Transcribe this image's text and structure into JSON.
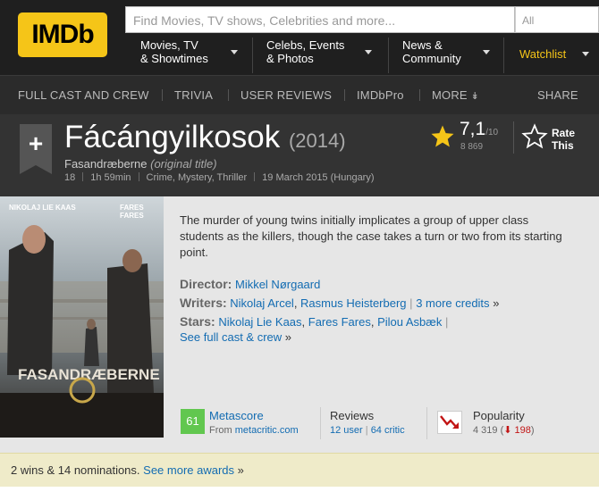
{
  "header": {
    "logo": "IMDb",
    "search_placeholder": "Find Movies, TV shows, Celebrities and more...",
    "search_category": "All",
    "nav": [
      {
        "line1": "Movies, TV",
        "line2": "& Showtimes"
      },
      {
        "line1": "Celebs, Events",
        "line2": "& Photos"
      },
      {
        "line1": "News &",
        "line2": "Community"
      }
    ],
    "watchlist": "Watchlist"
  },
  "subnav": {
    "items": [
      "FULL CAST AND CREW",
      "TRIVIA",
      "USER REVIEWS",
      "IMDbPro",
      "MORE"
    ],
    "share": "SHARE"
  },
  "title": {
    "name": "Fácángyilkosok",
    "year": "(2014)",
    "original": "Fasandræberne",
    "original_note": "(original title)",
    "certificate": "18",
    "runtime": "1h 59min",
    "genres": "Crime, Mystery, Thriller",
    "release": "19 March 2015 (Hungary)",
    "rating": "7,1",
    "rating_max": "/10",
    "votes": "8 869",
    "rate_line1": "Rate",
    "rate_line2": "This"
  },
  "poster": {
    "actor_left": "NIKOLAJ LIE KAAS",
    "actor_right": "FARES FARES",
    "title": "FASANDRÆBERNE"
  },
  "summary": "The murder of young twins initially implicates a group of upper class students as the killers, though the case takes a turn or two from its starting point.",
  "credits": {
    "director_label": "Director:",
    "director": "Mikkel Nørgaard",
    "writers_label": "Writers:",
    "writer1": "Nikolaj Arcel",
    "writer2": "Rasmus Heisterberg",
    "writers_more": "3 more credits",
    "stars_label": "Stars:",
    "star1": "Nikolaj Lie Kaas",
    "star2": "Fares Fares",
    "star3": "Pilou Asbæk",
    "full_cast": "See full cast & crew"
  },
  "metascore": {
    "value": "61",
    "label": "Metascore",
    "from": "From",
    "source": "metacritic.com"
  },
  "reviews": {
    "label": "Reviews",
    "user": "12 user",
    "critic": "64 critic"
  },
  "popularity": {
    "label": "Popularity",
    "rank": "4 319",
    "change": "198"
  },
  "awards": {
    "text": "2 wins & 14 nominations.",
    "link": "See more awards"
  },
  "colors": {
    "brand": "#f5c518",
    "link": "#136cb2",
    "metascore": "#61c74f",
    "popularity_down": "#c21515"
  }
}
